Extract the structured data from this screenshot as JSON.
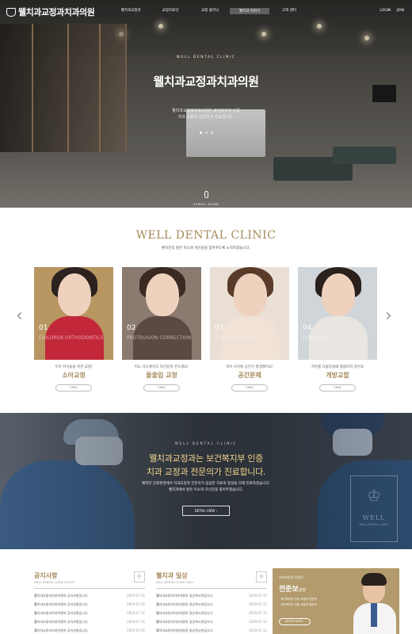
{
  "header": {
    "logo_text": "웰치과교정과치과의원",
    "nav": [
      {
        "label": "웰치과교정과"
      },
      {
        "label": "교정치료안"
      },
      {
        "label": "교정 클리닉"
      },
      {
        "label": "웰치과 이야기"
      },
      {
        "label": "고객 센터"
      }
    ],
    "util": [
      "LOGIN",
      "JOIN"
    ]
  },
  "hero": {
    "subtitle": "WELL DENTAL CLINIC",
    "title": "웰치과교정과치과의원",
    "desc_line1": "웰치과교정과치과의원은 보건복지부 인증",
    "desc_line2": "치과 교정과 전문의가 진료합니다.",
    "scroll_label": "SCROLL DOWN"
  },
  "clinic": {
    "title": "WELL DENTAL CLINIC",
    "desc": "환자분의 밝은 미소와 자신감을 찾아주도록 노력하겠습니다.",
    "prev_arrow": "‹",
    "next_arrow": "›",
    "cards": [
      {
        "num": "01",
        "eng": "CHILDREN ORTHODONTICS",
        "caption": "우리 아이들을 위한 교정!",
        "name": "소아교정",
        "button": "VIEW"
      },
      {
        "num": "02",
        "eng": "PROTRUSION CORRECTION",
        "caption": "어느 각도에서도 자신있게 웃으세요!",
        "name": "돌출입 교정",
        "button": "VIEW"
      },
      {
        "num": "03",
        "eng": "SPACE PROBLEM",
        "caption": "치아 사이에 공간이 발생했어요!",
        "name": "공간문제",
        "button": "VIEW"
      },
      {
        "num": "04",
        "eng": "OPEN BITE",
        "caption": "치아를 다물었을때 벌물리지 않아요",
        "name": "개방교합",
        "button": "VIEW"
      }
    ]
  },
  "banner": {
    "subtitle": "WELL DENTAL CLINIC",
    "title_line1": "웰치과교정과는 보건복지부 인증",
    "title_line2": "치과 교정과 전문의가 진료합니다.",
    "desc_line1": "쾌적한 진료환경에서 치과교정과 전문의가 꼼꼼한 치료로 정성을 다해 진료하겠습니다.",
    "desc_line2": "웰치과에서 밝은 미소와 자신감을 찾아주겠습니다.",
    "button": "DETAIL VIEW  ›",
    "emblem_text": "WELL",
    "emblem_sub": "WELL DENTAL CLINIC"
  },
  "notice": {
    "title": "공지사항",
    "eng": "WELL DENTAL CLINIC NOTICE",
    "plus": "+",
    "items": [
      {
        "text": "웰치과교정과치과의원의 공지사항입니다.",
        "date": "2019.07.11"
      },
      {
        "text": "웰치과교정과치과의원의 공지사항입니다.",
        "date": "2019.07.11"
      },
      {
        "text": "웰치과교정과치과의원의 공지사항입니다.",
        "date": "2019.07.11"
      },
      {
        "text": "웰치과교정과치과의원의 공지사항입니다.",
        "date": "2019.07.11"
      },
      {
        "text": "웰치과교정과치과의원의 공지사항입니다.",
        "date": "2019.07.11"
      }
    ]
  },
  "daily": {
    "title": "웰치과 일상",
    "eng": "WELL DENTAL CLINIC DAILY",
    "plus": "+",
    "items": [
      {
        "text": "웰치과교정과치과의원의 일상게시판입니다.",
        "date": "2019.07.11"
      },
      {
        "text": "웰치과교정과치과의원의 일상게시판입니다.",
        "date": "2019.07.11"
      },
      {
        "text": "웰치과교정과치과의원의 일상게시판입니다.",
        "date": "2019.07.11"
      },
      {
        "text": "웰치과교정과치과의원의 일상게시판입니다.",
        "date": "2019.07.11"
      },
      {
        "text": "웰치과교정과치과의원의 일상게시판입니다.",
        "date": "2019.07.11"
      }
    ]
  },
  "doctor": {
    "subtitle": "치과교정과 전문의",
    "name": "전준보",
    "role": "원장",
    "credentials": [
      "- 보건복지부 인증 교정과 전문의",
      "- 보건복지부 인증 교정과 전문의"
    ],
    "button": "MORE VIEW  ›"
  },
  "colors": {
    "accent": "#a68a5b",
    "gold_banner": "#b39b6d",
    "banner_title": "#f2d58c"
  }
}
